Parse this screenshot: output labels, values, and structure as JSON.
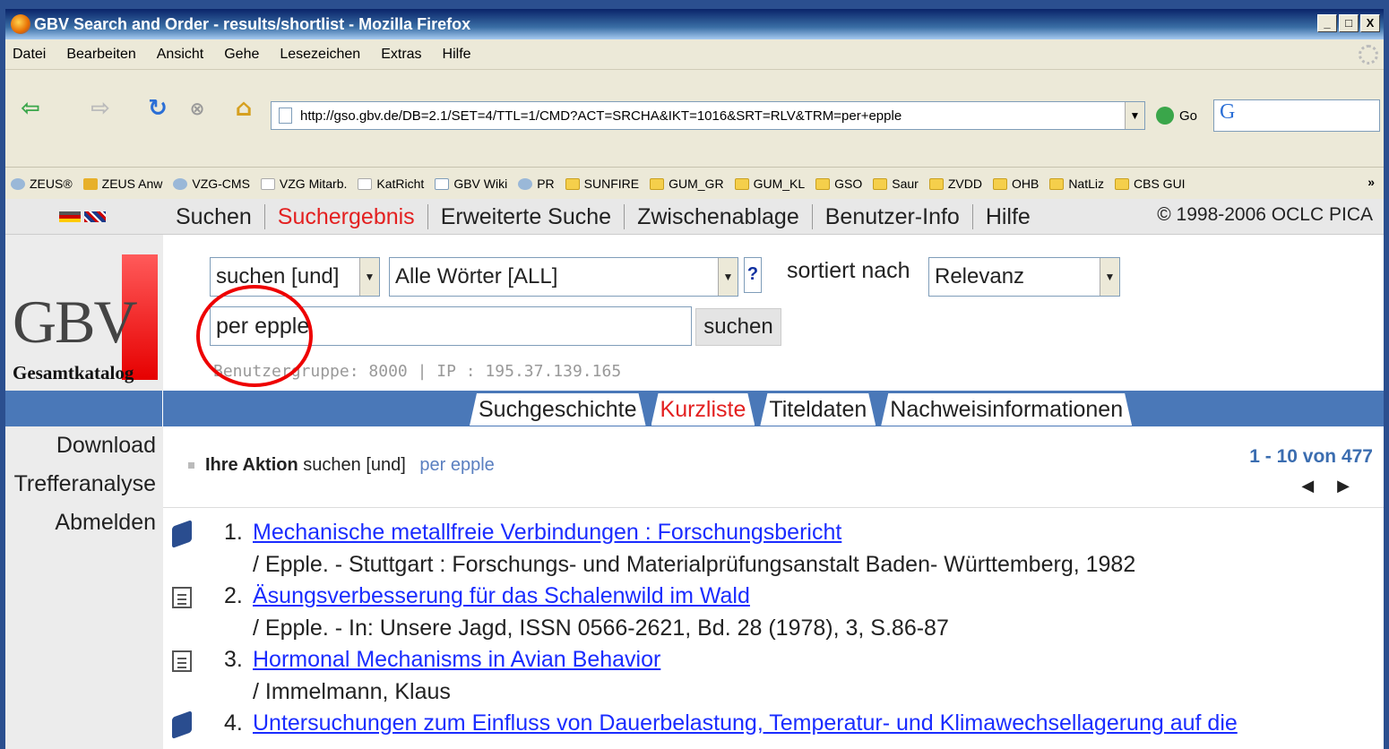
{
  "window": {
    "title": "GBV Search and Order - results/shortlist - Mozilla Firefox",
    "controls": [
      "_",
      "□",
      "X"
    ]
  },
  "menubar": [
    "Datei",
    "Bearbeiten",
    "Ansicht",
    "Gehe",
    "Lesezeichen",
    "Extras",
    "Hilfe"
  ],
  "navbar": {
    "url": "http://gso.gbv.de/DB=2.1/SET=4/TTL=1/CMD?ACT=SRCHA&IKT=1016&SRT=RLV&TRM=per+epple",
    "go_label": "Go",
    "search_logo": "G"
  },
  "bookmarks": [
    {
      "label": "ZEUS®",
      "icon": "circle-icon"
    },
    {
      "label": "ZEUS Anw",
      "icon": "star-icon"
    },
    {
      "label": "VZG-CMS",
      "icon": "circle-icon"
    },
    {
      "label": "VZG Mitarb.",
      "icon": "g-icon"
    },
    {
      "label": "KatRicht",
      "icon": "g-icon"
    },
    {
      "label": "GBV Wiki",
      "icon": "page-icon"
    },
    {
      "label": "PR",
      "icon": "circle-icon"
    },
    {
      "label": "SUNFIRE",
      "icon": "folder-icon"
    },
    {
      "label": "GUM_GR",
      "icon": "folder-icon"
    },
    {
      "label": "GUM_KL",
      "icon": "folder-icon"
    },
    {
      "label": "GSO",
      "icon": "folder-icon"
    },
    {
      "label": "Saur",
      "icon": "folder-icon"
    },
    {
      "label": "ZVDD",
      "icon": "folder-icon"
    },
    {
      "label": "OHB",
      "icon": "folder-icon"
    },
    {
      "label": "NatLiz",
      "icon": "folder-icon"
    },
    {
      "label": "CBS GUI",
      "icon": "folder-icon"
    }
  ],
  "bookmarks_more": "»",
  "site": {
    "tabs": [
      "Suchen",
      "Suchergebnis",
      "Erweiterte Suche",
      "Zwischenablage",
      "Benutzer-Info",
      "Hilfe"
    ],
    "copyright": "© 1998-2006 OCLC PICA",
    "logo_text": "GBV",
    "logo_sub": "Gesamtkatalog"
  },
  "form": {
    "operator": "suchen [und]",
    "index": "Alle Wörter [ALL]",
    "help": "?",
    "sort_label": "sortiert nach",
    "sort_value": "Relevanz",
    "query": "per epple",
    "search_button": "suchen",
    "user_info": "Benutzergruppe: 8000 | IP : 195.37.139.165"
  },
  "subtabs": [
    "Suchgeschichte",
    "Kurzliste",
    "Titeldaten",
    "Nachweisinformationen"
  ],
  "sidemenu": [
    "Download",
    "Trefferanalyse",
    "Abmelden"
  ],
  "action": {
    "label": "Ihre Aktion",
    "operator": "suchen [und]",
    "term": "per epple"
  },
  "pagination": {
    "range": "1 - 10 von 477",
    "prev": "◀",
    "next": "▶"
  },
  "results": [
    {
      "num": "1.",
      "title": "Mechanische metallfreie Verbindungen : Forschungsbericht",
      "sub": "/ Epple. - Stuttgart : Forschungs- und Materialprüfungsanstalt Baden- Württemberg, 1982",
      "icon": "book-icon"
    },
    {
      "num": "2.",
      "title": "Äsungsverbesserung für das Schalenwild im Wald",
      "sub": "/ Epple. - In: Unsere Jagd, ISSN 0566-2621, Bd. 28 (1978), 3, S.86-87",
      "icon": "document-icon"
    },
    {
      "num": "3.",
      "title": "Hormonal Mechanisms in Avian Behavior",
      "sub": "/ Immelmann, Klaus",
      "icon": "document-icon"
    },
    {
      "num": "4.",
      "title": "Untersuchungen zum Einfluss von Dauerbelastung, Temperatur- und Klimawechsellagerung auf die",
      "sub": "",
      "icon": "book-icon"
    }
  ],
  "colors": {
    "accent_blue": "#4a78b8",
    "link": "#1a2cff",
    "active_tab": "#e32020",
    "highlight_circle": "#e00000"
  }
}
